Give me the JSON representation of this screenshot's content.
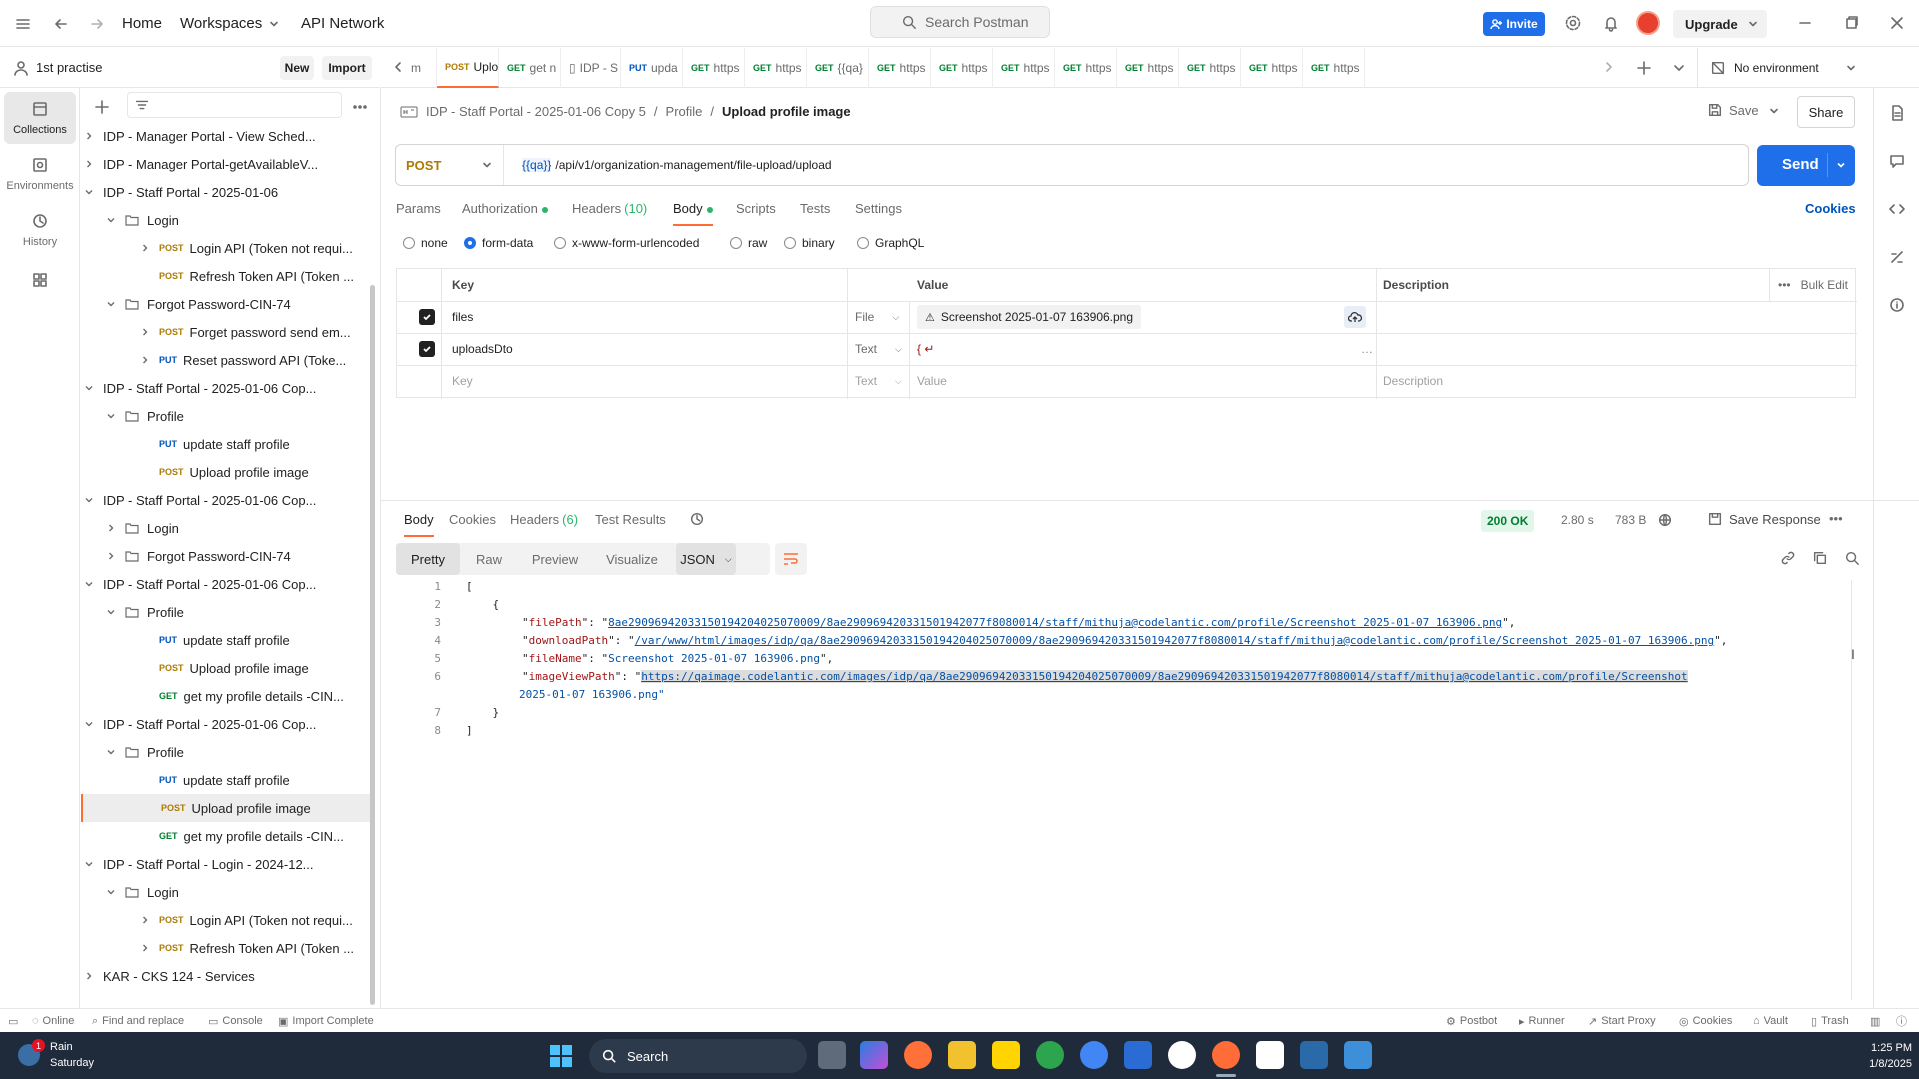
{
  "header": {
    "nav": [
      "Home",
      "Workspaces",
      "API Network"
    ],
    "search_placeholder": "Search Postman",
    "invite": "Invite",
    "upgrade": "Upgrade"
  },
  "workspace": {
    "name": "1st practise",
    "new_label": "New",
    "import_label": "Import"
  },
  "rail": [
    {
      "label": "Collections",
      "icon": "collections-icon"
    },
    {
      "label": "Environments",
      "icon": "environments-icon"
    },
    {
      "label": "History",
      "icon": "history-icon"
    },
    {
      "label": "",
      "icon": "apps-icon"
    }
  ],
  "tree": [
    {
      "indent": 0,
      "kind": "coll",
      "label": "IDP - Manager Portal - View Sched..."
    },
    {
      "indent": 0,
      "kind": "coll",
      "label": "IDP - Manager Portal-getAvailableV..."
    },
    {
      "indent": 0,
      "kind": "coll",
      "open": true,
      "label": "IDP - Staff Portal - 2025-01-06"
    },
    {
      "indent": 1,
      "kind": "folder",
      "open": true,
      "label": "Login"
    },
    {
      "indent": 2,
      "kind": "req",
      "method": "POST",
      "chev": true,
      "label": "Login API (Token not requi..."
    },
    {
      "indent": 2,
      "kind": "req",
      "method": "POST",
      "label": "Refresh Token API (Token ..."
    },
    {
      "indent": 1,
      "kind": "folder",
      "open": true,
      "label": "Forgot Password-CIN-74"
    },
    {
      "indent": 2,
      "kind": "req",
      "method": "POST",
      "chev": true,
      "label": "Forget password send em..."
    },
    {
      "indent": 2,
      "kind": "req",
      "method": "PUT",
      "chev": true,
      "label": "Reset password API (Toke..."
    },
    {
      "indent": 0,
      "kind": "coll",
      "open": true,
      "label": "IDP - Staff Portal - 2025-01-06 Cop..."
    },
    {
      "indent": 1,
      "kind": "folder",
      "open": true,
      "label": "Profile"
    },
    {
      "indent": 2,
      "kind": "req",
      "method": "PUT",
      "label": "update staff profile"
    },
    {
      "indent": 2,
      "kind": "req",
      "method": "POST",
      "label": "Upload profile image"
    },
    {
      "indent": 0,
      "kind": "coll",
      "open": true,
      "label": "IDP - Staff Portal - 2025-01-06 Cop..."
    },
    {
      "indent": 1,
      "kind": "folder",
      "label": "Login"
    },
    {
      "indent": 1,
      "kind": "folder",
      "label": "Forgot Password-CIN-74"
    },
    {
      "indent": 0,
      "kind": "coll",
      "open": true,
      "label": "IDP - Staff Portal - 2025-01-06 Cop..."
    },
    {
      "indent": 1,
      "kind": "folder",
      "open": true,
      "label": "Profile"
    },
    {
      "indent": 2,
      "kind": "req",
      "method": "PUT",
      "label": "update staff profile"
    },
    {
      "indent": 2,
      "kind": "req",
      "method": "POST",
      "label": "Upload profile image"
    },
    {
      "indent": 2,
      "kind": "req",
      "method": "GET",
      "label": "get my profile details -CIN..."
    },
    {
      "indent": 0,
      "kind": "coll",
      "open": true,
      "label": "IDP - Staff Portal - 2025-01-06 Cop..."
    },
    {
      "indent": 1,
      "kind": "folder",
      "open": true,
      "label": "Profile"
    },
    {
      "indent": 2,
      "kind": "req",
      "method": "PUT",
      "label": "update staff profile"
    },
    {
      "indent": 2,
      "kind": "req",
      "method": "POST",
      "label": "Upload profile image",
      "selected": true
    },
    {
      "indent": 2,
      "kind": "req",
      "method": "GET",
      "label": "get my profile details -CIN..."
    },
    {
      "indent": 0,
      "kind": "coll",
      "open": true,
      "label": "IDP - Staff Portal - Login - 2024-12..."
    },
    {
      "indent": 1,
      "kind": "folder",
      "open": true,
      "label": "Login"
    },
    {
      "indent": 2,
      "kind": "req",
      "method": "POST",
      "chev": true,
      "label": "Login API (Token not requi..."
    },
    {
      "indent": 2,
      "kind": "req",
      "method": "POST",
      "chev": true,
      "label": "Refresh Token API (Token ..."
    },
    {
      "indent": 0,
      "kind": "coll",
      "label": "KAR - CKS 124 - Services"
    }
  ],
  "tabs": [
    {
      "method": "",
      "label": "m",
      "dot": false
    },
    {
      "method": "POST",
      "label": "Uplo",
      "dot": true,
      "active": true
    },
    {
      "method": "GET",
      "label": "get n",
      "dot": true
    },
    {
      "method": "",
      "label": "IDP - S",
      "dot": false,
      "doc": true
    },
    {
      "method": "PUT",
      "label": "upda",
      "dot": true
    },
    {
      "method": "GET",
      "label": "https",
      "dot": true
    },
    {
      "method": "GET",
      "label": "https",
      "dot": true
    },
    {
      "method": "GET",
      "label": "{{qa}",
      "dot": true
    },
    {
      "method": "GET",
      "label": "https",
      "dot": true
    },
    {
      "method": "GET",
      "label": "https",
      "dot": true
    },
    {
      "method": "GET",
      "label": "https",
      "dot": true
    },
    {
      "method": "GET",
      "label": "https",
      "dot": true
    },
    {
      "method": "GET",
      "label": "https",
      "dot": true
    },
    {
      "method": "GET",
      "label": "https",
      "dot": true
    },
    {
      "method": "GET",
      "label": "https",
      "dot": true
    },
    {
      "method": "GET",
      "label": "https",
      "dot": true
    }
  ],
  "environment": "No environment",
  "breadcrumb": {
    "collection": "IDP - Staff Portal - 2025-01-06 Copy 5",
    "folder": "Profile",
    "request": "Upload profile image"
  },
  "actions": {
    "save": "Save",
    "share": "Share"
  },
  "request": {
    "method": "POST",
    "url_var": "{{qa}}",
    "url_path": "/api/v1/organization-management/file-upload/upload",
    "send": "Send"
  },
  "req_tabs": [
    {
      "label": "Params"
    },
    {
      "label": "Authorization",
      "dot": true
    },
    {
      "label": "Headers",
      "count": "(10)"
    },
    {
      "label": "Body",
      "dot": true,
      "active": true
    },
    {
      "label": "Scripts"
    },
    {
      "label": "Tests"
    },
    {
      "label": "Settings"
    }
  ],
  "cookies_link": "Cookies",
  "body_types": [
    {
      "label": "none"
    },
    {
      "label": "form-data",
      "selected": true
    },
    {
      "label": "x-www-form-urlencoded"
    },
    {
      "label": "raw"
    },
    {
      "label": "binary"
    },
    {
      "label": "GraphQL"
    }
  ],
  "form_table": {
    "headers": {
      "key": "Key",
      "value": "Value",
      "description": "Description",
      "bulk": "Bulk Edit"
    },
    "rows": [
      {
        "key": "files",
        "type": "File",
        "value": "Screenshot 2025-01-07 163906.png",
        "checked": true
      },
      {
        "key": "uploadsDto",
        "type": "Text",
        "value": "{ ↵",
        "checked": true
      }
    ],
    "placeholder": {
      "key": "Key",
      "type": "Text",
      "value": "Value",
      "description": "Description"
    }
  },
  "response": {
    "tabs": [
      {
        "label": "Body",
        "active": true
      },
      {
        "label": "Cookies"
      },
      {
        "label": "Headers",
        "count": "(6)"
      },
      {
        "label": "Test Results"
      }
    ],
    "status": "200 OK",
    "time": "2.80 s",
    "size": "783 B",
    "save_response": "Save Response",
    "views": [
      "Pretty",
      "Raw",
      "Preview",
      "Visualize"
    ],
    "format": "JSON",
    "lines": [
      {
        "n": "1",
        "t": "["
      },
      {
        "n": "2",
        "t": "    {"
      },
      {
        "n": "3",
        "key": "filePath",
        "val": "8ae2909694203315019420402507000​9/8ae2909694203315019420​77f8080014/staff/mithuja@codelantic.com/profile/Screenshot 2025-01-07 163906.png"
      },
      {
        "n": "4",
        "key": "downloadPath",
        "val": "/var/www/html/images/idp/qa/8ae290969420331501942040250700​09/8ae29096942033150194207​7f8080014/staff/mithuja@codelantic.com/profile/Screenshot 2025-01-07 163906.png"
      },
      {
        "n": "5",
        "key": "fileName",
        "val": "Screenshot 2025-01-07 163906.png"
      },
      {
        "n": "6",
        "key": "imageViewPath",
        "val": "https://qaimage.codelantic.com/images/idp/qa/8ae29096942033150194204025070009/8ae290969420331501942077f8080014/staff/mithuja@codelantic.com/profile/Screenshot"
      },
      {
        "n": "",
        "t": "        2025-01-07 163906.png\""
      },
      {
        "n": "7",
        "t": "    }"
      },
      {
        "n": "8",
        "t": "]"
      }
    ]
  },
  "statusbar": {
    "left": [
      "Online",
      "Find and replace",
      "Console",
      "Import Complete"
    ],
    "right": [
      "Postbot",
      "Runner",
      "Start Proxy",
      "Cookies",
      "Vault",
      "Trash"
    ]
  },
  "taskbar": {
    "weather": "Rain",
    "day": "Saturday",
    "badge": "1",
    "search": "Search",
    "time": "1:25 PM",
    "date": "1/8/2025"
  }
}
